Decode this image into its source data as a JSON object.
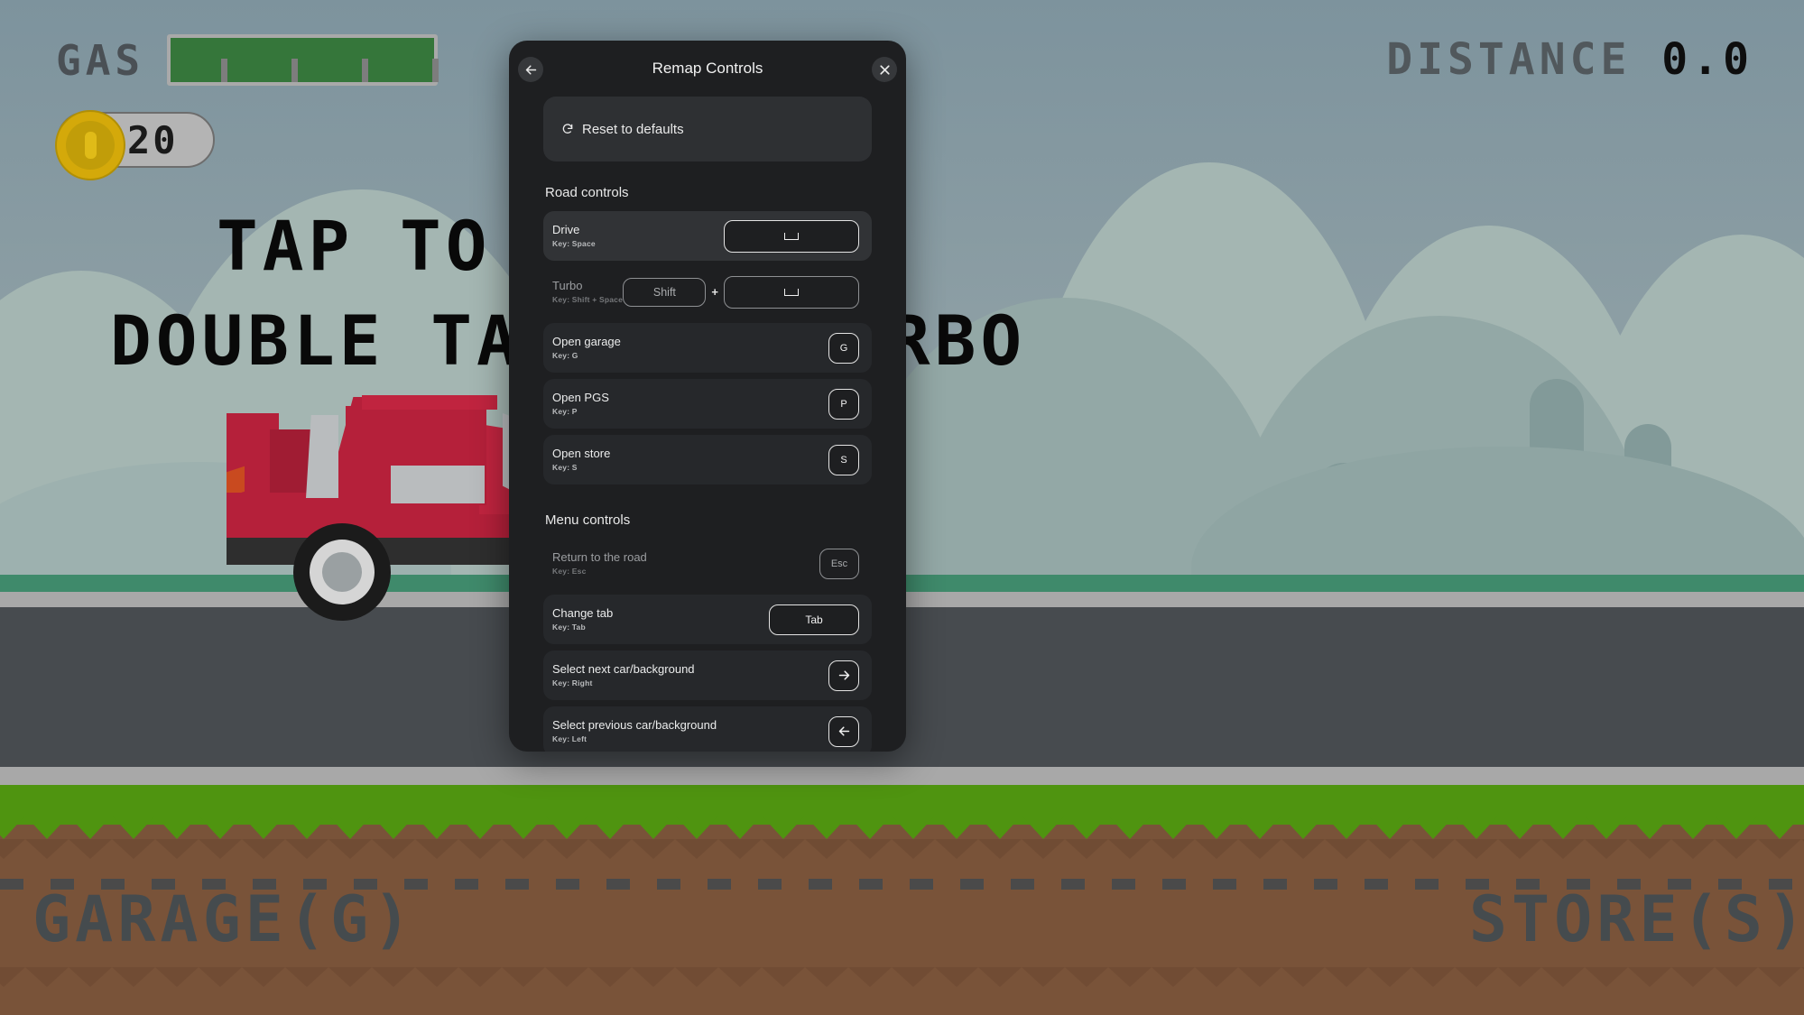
{
  "game": {
    "gas_label": "GAS",
    "gas_percent": 100,
    "coins": "20",
    "distance_label": "DISTANCE",
    "distance_value": "0.0",
    "hint_line_1": "TAP TO DRIVE",
    "hint_line_2": "DOUBLE TAP FOR TURBO",
    "garage_label": "GARAGE(G)",
    "store_label": "STORE(S)",
    "colors": {
      "sky": "#8497a0",
      "grass": "#4f9410",
      "road": "#474b4f",
      "dirt": "#795339",
      "gas_fill": "#35763a",
      "coin": "#d4a90a",
      "car_body": "#b5203a"
    }
  },
  "modal": {
    "title": "Remap Controls",
    "back_icon": "arrow-left-icon",
    "close_icon": "close-icon",
    "reset": {
      "icon": "reset-icon",
      "label": "Reset to defaults"
    },
    "sections": [
      {
        "title": "Road controls",
        "rows": [
          {
            "name": "Drive",
            "key_label": "Key: Space",
            "state": "hover",
            "keys": [
              {
                "type": "space",
                "label": "␣",
                "size": "wide"
              }
            ]
          },
          {
            "name": "Turbo",
            "key_label": "Key: Shift + Space",
            "state": "plain",
            "keys": [
              {
                "type": "text",
                "label": "Shift",
                "size": "mid"
              },
              {
                "type": "plus",
                "label": "+"
              },
              {
                "type": "space",
                "label": "␣",
                "size": "wide"
              }
            ]
          },
          {
            "name": "Open garage",
            "key_label": "Key: G",
            "state": "normal",
            "keys": [
              {
                "type": "text",
                "label": "G",
                "size": "sq"
              }
            ]
          },
          {
            "name": "Open PGS",
            "key_label": "Key: P",
            "state": "normal",
            "keys": [
              {
                "type": "text",
                "label": "P",
                "size": "sq"
              }
            ]
          },
          {
            "name": "Open store",
            "key_label": "Key: S",
            "state": "normal",
            "keys": [
              {
                "type": "text",
                "label": "S",
                "size": "sq"
              }
            ]
          }
        ]
      },
      {
        "title": "Menu controls",
        "rows": [
          {
            "name": "Return to the road",
            "key_label": "Key: Esc",
            "state": "plain",
            "keys": [
              {
                "type": "text",
                "label": "Esc",
                "size": "esc"
              }
            ]
          },
          {
            "name": "Change tab",
            "key_label": "Key: Tab",
            "state": "normal",
            "keys": [
              {
                "type": "text",
                "label": "Tab",
                "size": "tab"
              }
            ]
          },
          {
            "name": "Select next car/background",
            "key_label": "Key: Right",
            "state": "normal",
            "keys": [
              {
                "type": "icon",
                "label": "arrow-right-icon",
                "size": "sq"
              }
            ]
          },
          {
            "name": "Select previous car/background",
            "key_label": "Key: Left",
            "state": "normal",
            "keys": [
              {
                "type": "icon",
                "label": "arrow-left-icon",
                "size": "sq"
              }
            ]
          }
        ]
      }
    ]
  }
}
